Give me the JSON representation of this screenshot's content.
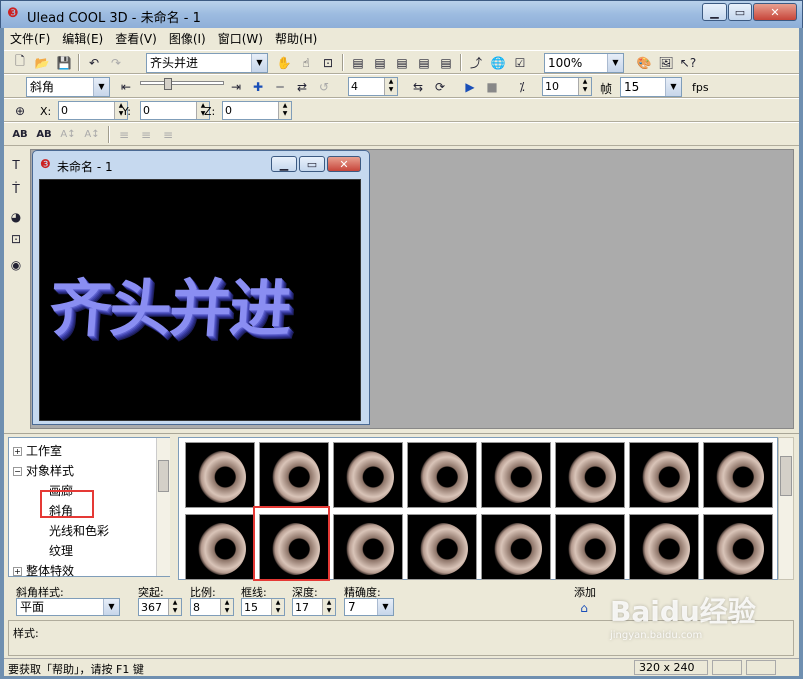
{
  "window": {
    "title": "Ulead COOL 3D - 未命名 - 1",
    "min_icon": "minimize-icon",
    "max_icon": "maximize-icon",
    "close_icon": "close-icon"
  },
  "menu": [
    "文件(F)",
    "编辑(E)",
    "查看(V)",
    "图像(I)",
    "窗口(W)",
    "帮助(H)"
  ],
  "toolbar1": {
    "object_combo": "齐头并进",
    "zoom_combo": "100%"
  },
  "toolbar2": {
    "effect_combo": "斜角",
    "frame_value": "4",
    "frames_value": "10",
    "frames_label": "帧",
    "fps_value": "15",
    "fps_label": "fps"
  },
  "toolbar3": {
    "x_label": "X:",
    "x_value": "0",
    "y_label": "Y:",
    "y_value": "0",
    "z_label": "Z:",
    "z_value": "0"
  },
  "document": {
    "title": "未命名 - 1",
    "text": "齐头并进"
  },
  "tree": {
    "items": [
      {
        "label": "工作室",
        "expander": "+"
      },
      {
        "label": "对象样式",
        "expander": "−"
      },
      {
        "label": "画廊"
      },
      {
        "label": "斜角"
      },
      {
        "label": "光线和色彩"
      },
      {
        "label": "纹理"
      },
      {
        "label": "整体特效",
        "expander": "+"
      }
    ]
  },
  "thumbnails": {
    "count": 16,
    "selected_index": 9
  },
  "props": {
    "bevel_style_label": "斜角样式:",
    "bevel_style_value": "平面",
    "protrude_label": "突起:",
    "protrude_value": "367",
    "scale_label": "比例:",
    "scale_value": "8",
    "frame_label": "框线:",
    "frame_value": "15",
    "depth_label": "深度:",
    "depth_value": "17",
    "precision_label": "精确度:",
    "precision_value": "7",
    "add_label": "添加",
    "style_label": "样式:"
  },
  "status": {
    "help_text": "要获取「帮助」，请按 F1 键",
    "size": "320 x 240"
  },
  "watermark": {
    "main": "Baidu经验",
    "sub": "jingyan.baidu.com"
  }
}
